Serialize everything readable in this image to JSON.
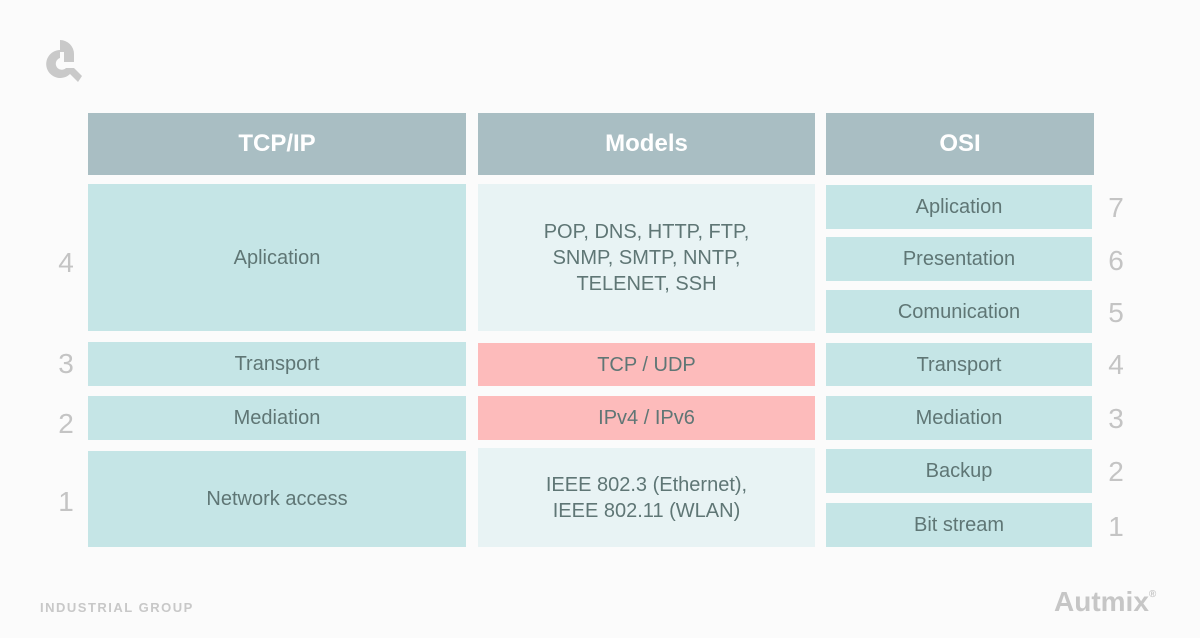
{
  "header": {
    "tcpip": "TCP/IP",
    "models": "Models",
    "osi": "OSI"
  },
  "tcpip_layers": [
    {
      "num": "4",
      "label": "Aplication"
    },
    {
      "num": "3",
      "label": "Transport"
    },
    {
      "num": "2",
      "label": "Mediation"
    },
    {
      "num": "1",
      "label": "Network access"
    }
  ],
  "models": [
    {
      "lines": [
        "POP, DNS, HTTP, FTP,",
        "SNMP, SMTP, NNTP,",
        "TELENET, SSH"
      ]
    },
    {
      "lines": [
        "TCP / UDP"
      ]
    },
    {
      "lines": [
        "IPv4 / IPv6"
      ]
    },
    {
      "lines": [
        "IEEE 802.3 (Ethernet),",
        "IEEE 802.11 (WLAN)"
      ]
    }
  ],
  "osi_layers": [
    {
      "num": "7",
      "label": "Aplication"
    },
    {
      "num": "6",
      "label": "Presentation"
    },
    {
      "num": "5",
      "label": "Comunication"
    },
    {
      "num": "4",
      "label": "Transport"
    },
    {
      "num": "3",
      "label": "Mediation"
    },
    {
      "num": "2",
      "label": "Backup"
    },
    {
      "num": "1",
      "label": "Bit stream"
    }
  ],
  "footer": {
    "left": "INDUSTRIAL GROUP",
    "brand": "Autmix",
    "brand_mark": "®"
  },
  "colors": {
    "header_bg": "#a9bec3",
    "layer_teal": "#c5e5e6",
    "model_pale": "#e8f3f4",
    "model_highlight": "#fdbbbb",
    "text": "#5f7675",
    "muted": "#c4c4c4"
  }
}
